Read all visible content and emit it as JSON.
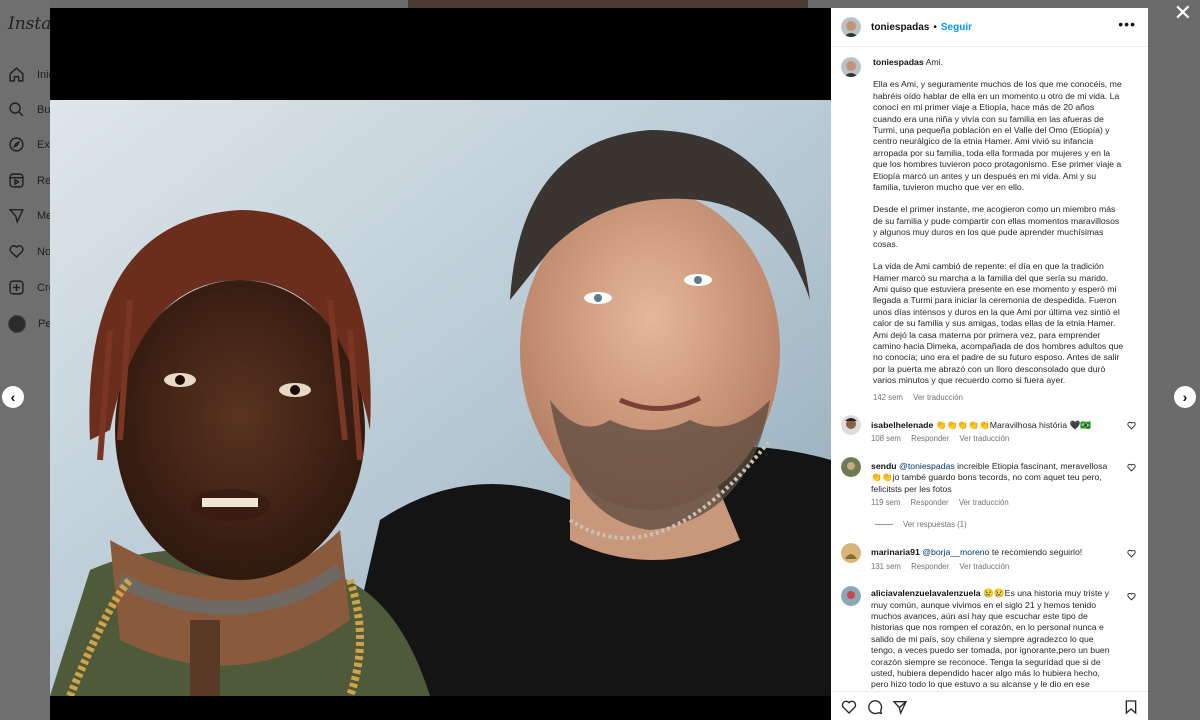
{
  "background": {
    "logo": "Instagram",
    "nav": [
      {
        "label": "Inicio",
        "icon": "home-icon"
      },
      {
        "label": "Buscar",
        "icon": "search-icon"
      },
      {
        "label": "Explorar",
        "icon": "explore-icon"
      },
      {
        "label": "Reels",
        "icon": "reels-icon"
      },
      {
        "label": "Mensajes",
        "icon": "messages-icon"
      },
      {
        "label": "Notificaciones",
        "icon": "heart-icon"
      },
      {
        "label": "Crear",
        "icon": "create-icon"
      },
      {
        "label": "Perfil",
        "icon": "profile-avatar"
      }
    ]
  },
  "header": {
    "username": "toniespadas",
    "separator": "•",
    "follow_label": "Seguir",
    "more_label": "•••"
  },
  "post": {
    "username": "toniespadas",
    "title": "Ami.",
    "paragraphs": [
      "Ella es Ami, y seguramente muchos de los que me conocéis, me habréis oído hablar de ella en un momento u otro de mi vida. La conocí en mi primer viaje a Etiopía, hace más de 20 años cuando era una niña y vivía con su familia en las afueras de Turmi, una pequeña población en el Valle del Omo (Etiopía) y centro neurálgico de la etnia Hamer. Ami vivió su infancia arropada por su familia, toda ella formada por mujeres y en la que los hombres tuvieron poco protagonismo. Ese primer viaje a Etiopía marcó un antes y un después en mi vida. Ami y su familia, tuvieron mucho que ver en ello.",
      "Desde el primer instante, me acogieron como un miembro más de su familia y pude compartir con ellas momentos maravillosos y algunos muy duros en los que pude aprender muchísimas cosas.",
      "La vida de Ami cambió de repente: el día en que la tradición Hamer marcó su marcha a la familia del que sería su marido. Ami quiso que estuviera presente en ese momento y esperó mi llegada a Turmi para iniciar la ceremonia de despedida. Fueron unos días intensos y duros en la que Ami por última vez sintió el calor de su familia y sus amigas, todas ellas de la etnia Hamer. Ami dejó la casa materna por primera vez, para emprender camino hacia Dimeka, acompañada de dos hombres adultos que no conocía; uno era el padre de su futuro esposo. Antes de salir por la puerta me abrazó con un lloro desconsolado que duró varios minutos y que recuerdo como si fuera ayer."
    ],
    "time": "142 sem",
    "translate": "Ver traducción"
  },
  "comments": [
    {
      "username": "isabelhelenade",
      "text": "👏👏👏👏👏Maravilhosa história 🖤🇧🇷",
      "time": "108 sem",
      "reply": "Responder",
      "translate": "Ver traducción"
    },
    {
      "username": "sendu",
      "mention": "@toniespadas",
      "text": " increible Etiopia fascinant, meravellosa👏👏jo també guardo bons tecords, no com aquet teu pero, felicitsts per les fotos",
      "time": "119 sem",
      "reply": "Responder",
      "translate": "Ver traducción",
      "view_replies": "Ver respuestas (1)"
    },
    {
      "username": "marinaria91",
      "mention": "@borja__moreno",
      "text": " te recomiendo seguirlo!",
      "time": "131 sem",
      "reply": "Responder",
      "translate": "Ver traducción"
    },
    {
      "username": "aliciavalenzuelavalenzuela",
      "text": " 😢😢Es una historia muy triste y muy común, aunque vivimos en el siglo 21 y hemos tenido muchos avances, aún así hay que escuchar este tipo de historias que nos rompen el corazón, en lo personal nunca e salido de mi país, soy chilena y siempre agradezco lo que tengo, a veces puedo ser tomada, por ignorante,pero un buen corazón siempre se reconoce. Tenga la seguridad que si de usted, hubiera dependido hacer algo más lo hubiera hecho, pero hizo todo lo que estuvo a su alcanse y le dio en ese"
    }
  ],
  "colors": {
    "accent": "#0095f6",
    "muted": "#737373"
  }
}
